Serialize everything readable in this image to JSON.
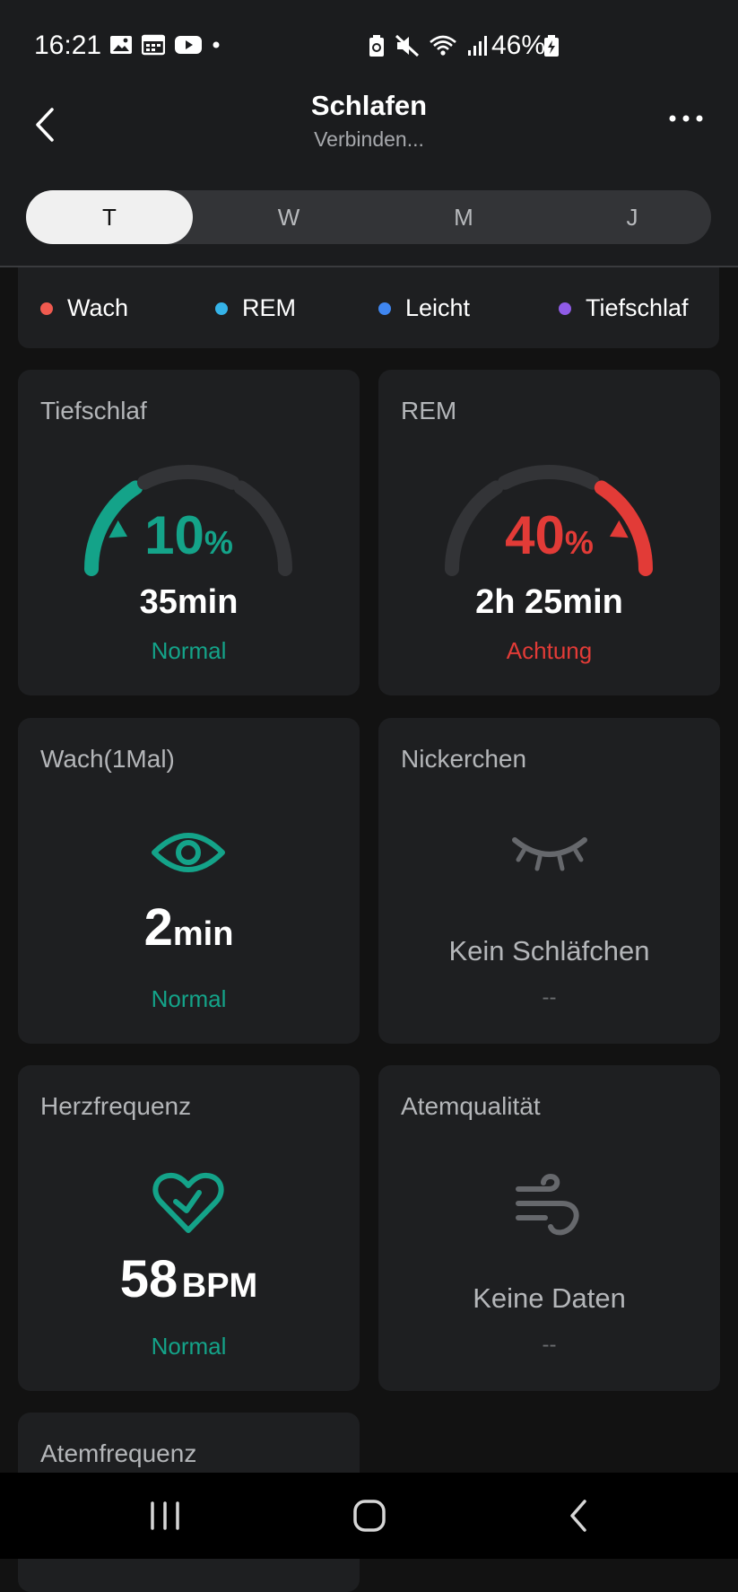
{
  "status_bar": {
    "time": "16:21",
    "battery": "46%"
  },
  "header": {
    "title": "Schlafen",
    "subtitle": "Verbinden..."
  },
  "tabs": [
    {
      "label": "T",
      "active": true
    },
    {
      "label": "W",
      "active": false
    },
    {
      "label": "M",
      "active": false
    },
    {
      "label": "J",
      "active": false
    }
  ],
  "legend": [
    {
      "label": "Wach",
      "color": "#f05a4f"
    },
    {
      "label": "REM",
      "color": "#35b3e8"
    },
    {
      "label": "Leicht",
      "color": "#3f86f0"
    },
    {
      "label": "Tiefschlaf",
      "color": "#8f5be6"
    }
  ],
  "cards": {
    "deep": {
      "title": "Tiefschlaf",
      "percent": "10",
      "unit": "%",
      "duration": "35min",
      "status": "Normal",
      "percent_value": 10,
      "color": "#14a389"
    },
    "rem": {
      "title": "REM",
      "percent": "40",
      "unit": "%",
      "duration": "2h 25min",
      "status": "Achtung",
      "percent_value": 40,
      "color": "#e23b37"
    },
    "awake": {
      "title": "Wach(1Mal)",
      "value": "2",
      "unit": "min",
      "status": "Normal"
    },
    "nap": {
      "title": "Nickerchen",
      "text": "Kein Schläfchen",
      "sub": "--"
    },
    "heart": {
      "title": "Herzfrequenz",
      "value": "58",
      "unit": "BPM",
      "status": "Normal"
    },
    "breath_quality": {
      "title": "Atemqualität",
      "text": "Keine Daten",
      "sub": "--"
    },
    "breath_rate": {
      "title": "Atemfrequenz"
    }
  },
  "colors": {
    "accent_green": "#14a389",
    "alert_red": "#e23b37",
    "card_bg": "#1e1f21"
  }
}
